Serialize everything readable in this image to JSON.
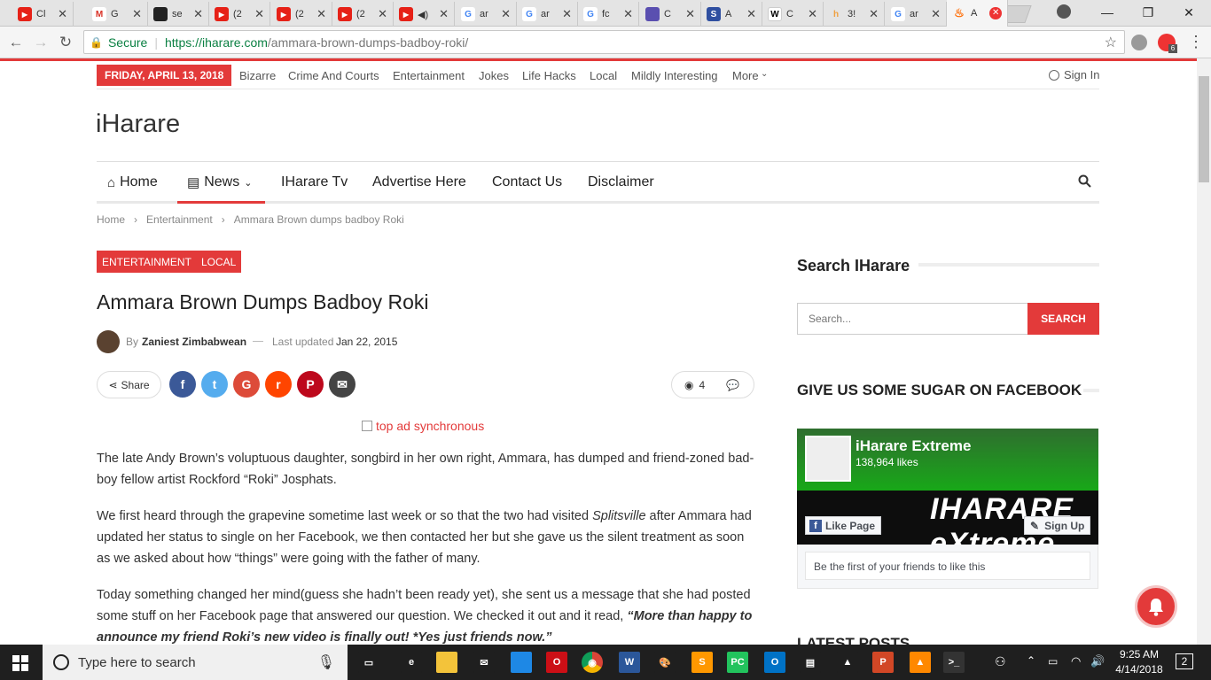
{
  "browser": {
    "tabs": [
      {
        "icon": "youtube-icon",
        "color": "#e62117",
        "title": "Cl"
      },
      {
        "icon": "gmail-icon",
        "color": "#d93025",
        "title": "G"
      },
      {
        "icon": "github-icon",
        "color": "#222222",
        "title": "se"
      },
      {
        "icon": "youtube-icon",
        "color": "#e62117",
        "title": "(2"
      },
      {
        "icon": "youtube-icon",
        "color": "#e62117",
        "title": "(2"
      },
      {
        "icon": "youtube-icon",
        "color": "#e62117",
        "title": "(2"
      },
      {
        "icon": "youtube-icon",
        "color": "#e62117",
        "title": "◀)"
      },
      {
        "icon": "google-icon",
        "color": "#4285f4",
        "title": "ar"
      },
      {
        "icon": "google-icon",
        "color": "#4285f4",
        "title": "ar"
      },
      {
        "icon": "google-icon",
        "color": "#4285f4",
        "title": "fc"
      },
      {
        "icon": "guitar-icon",
        "color": "#5a4fb0",
        "title": "C"
      },
      {
        "icon": "s-icon",
        "color": "#2f4fa0",
        "title": "A"
      },
      {
        "icon": "wikipedia-icon",
        "color": "#ffffff",
        "title": "C"
      },
      {
        "icon": "her-icon",
        "color": "#f0a040",
        "title": "3!"
      },
      {
        "icon": "google-icon",
        "color": "#4285f4",
        "title": "ar"
      },
      {
        "icon": "fire-icon",
        "color": "#ff6a00",
        "title": "A"
      }
    ],
    "address": {
      "secure_label": "Secure",
      "url_host": "https://iharare.com",
      "url_path": "/ammara-brown-dumps-badboy-roki/"
    },
    "extension_badge": "6"
  },
  "site": {
    "date_badge": "FRIDAY, APRIL 13, 2018",
    "top_links": [
      "Bizarre",
      "Crime And Courts",
      "Entertainment",
      "Jokes",
      "Life Hacks",
      "Local",
      "Mildly Interesting",
      "More"
    ],
    "sign_in": "Sign In",
    "logo": "iHarare",
    "main_nav": [
      "Home",
      "News",
      "IHarare Tv",
      "Advertise Here",
      "Contact Us",
      "Disclaimer"
    ],
    "breadcrumb": [
      "Home",
      "Entertainment",
      "Ammara Brown dumps badboy Roki"
    ]
  },
  "article": {
    "categories": [
      "ENTERTAINMENT",
      "LOCAL"
    ],
    "title": "Ammara Brown Dumps Badboy Roki",
    "by": "By",
    "author": "Zaniest Zimbabwean",
    "updated_label": "Last updated",
    "updated_date": "Jan 22, 2015",
    "share_label": "Share",
    "views": "4",
    "ad_alt": "top ad synchronous",
    "p1": "The late Andy Brown’s voluptuous daughter, songbird in her own right, Ammara, has dumped and friend-zoned bad-boy fellow artist Rockford “Roki” Josphats.",
    "p2_a": "We first heard through the grapevine sometime last week or so that the two had visited ",
    "p2_em": "Splitsville",
    "p2_b": " after Ammara had updated her status to single on her Facebook, we then contacted her but she gave us the silent treatment as soon as we asked about how “things” were going with the father of many.",
    "p3_a": "Today something changed her mind(guess she hadn’t been ready yet), she sent us a message that she had posted some stuff on her Facebook page that answered our question. We checked it out and it read, ",
    "p3_em": "“More than happy to announce my friend Roki’s new video is finally out! *Yes just friends now.”"
  },
  "sidebar": {
    "search_heading": "Search IHarare",
    "search_placeholder": "Search...",
    "search_button": "SEARCH",
    "fb_heading": "GIVE US SOME SUGAR ON FACEBOOK",
    "fb_page_name": "iHarare Extreme",
    "fb_likes": "138,964 likes",
    "fb_like_button": "Like Page",
    "fb_signup_button": "Sign Up",
    "fb_banner_text": "IHARARE eXtreme",
    "fb_friends_text": "Be the first of your friends to like this",
    "latest_heading": "LATEST POSTS"
  },
  "taskbar": {
    "search_placeholder": "Type here to search",
    "time": "9:25 AM",
    "date": "4/14/2018",
    "notif_count": "2"
  },
  "colors": {
    "accent": "#e33a3a",
    "facebook": "#3b5998",
    "twitter": "#55acee",
    "google": "#dd4b39",
    "reddit": "#ff4500",
    "pinterest": "#bd081c",
    "email": "#444444"
  }
}
